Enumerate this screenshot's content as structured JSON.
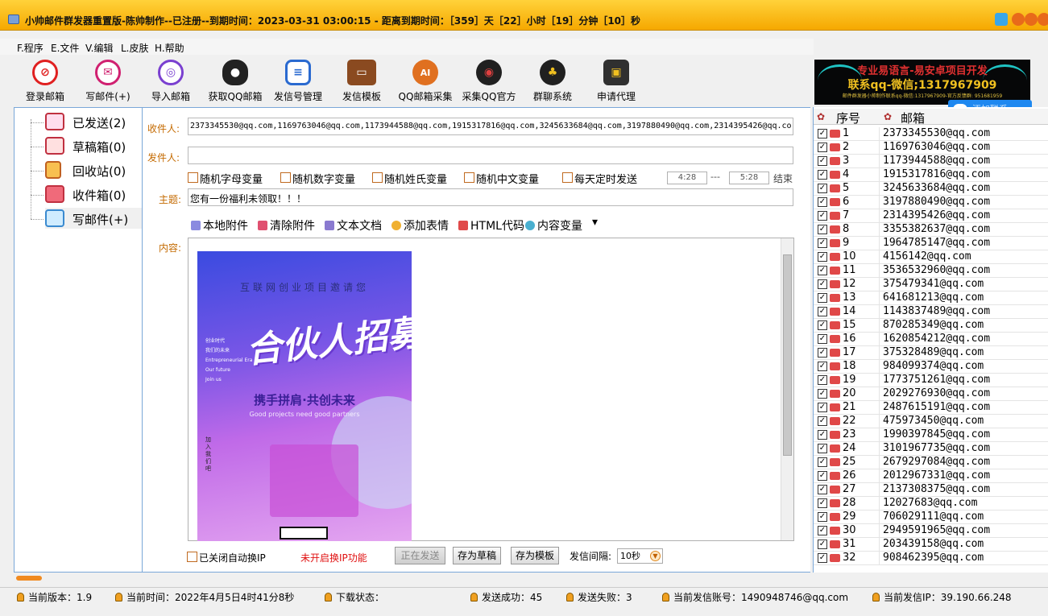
{
  "window": {
    "title": "小帅邮件群发器重置版-陈帅制作--已注册--到期时间：2023-03-31 03:00:15 - 距离到期时间：［359］天［22］小时［19］分钟［10］秒"
  },
  "menu": [
    "F.程序",
    "E.文件",
    "V.编辑",
    "L.皮肤",
    "H.帮助"
  ],
  "toolbar": [
    {
      "label": "登录邮箱",
      "icon": "login-icon",
      "color": "#e02020"
    },
    {
      "label": "写邮件(+)",
      "icon": "compose-icon",
      "color": "#d02070"
    },
    {
      "label": "导入邮箱",
      "icon": "import-icon",
      "color": "#7a40d0"
    },
    {
      "label": "获取QQ邮箱",
      "icon": "qq-penguin-icon",
      "color": "#222222"
    },
    {
      "label": "发信号管理",
      "icon": "account-manage-icon",
      "color": "#2a6ad0"
    },
    {
      "label": "发信模板",
      "icon": "wallet-icon",
      "color": "#8a4a20"
    },
    {
      "label": "QQ邮箱采集",
      "icon": "ai-collect-icon",
      "color": "#e07020"
    },
    {
      "label": "采集QQ官方",
      "icon": "globe-icon",
      "color": "#202020"
    },
    {
      "label": "群聊系统",
      "icon": "group-chat-icon",
      "color": "#202020"
    },
    {
      "label": "申请代理",
      "icon": "agent-icon",
      "color": "#303030"
    }
  ],
  "banner": {
    "line1": "专业易语言-易安卓项目开发",
    "line2": "联系qq-微信;1317967909",
    "line3": "邮件群发器小帅制作联系qq-微信:1317967909-官方反馈群: 951681959"
  },
  "blue_button": {
    "label": "添加联系"
  },
  "sidebar": [
    {
      "label": "已发送(2)",
      "icon": "sent-mail-icon"
    },
    {
      "label": "草稿箱(0)",
      "icon": "drafts-icon"
    },
    {
      "label": "回收站(0)",
      "icon": "trash-icon"
    },
    {
      "label": "收件箱(0)",
      "icon": "inbox-icon"
    },
    {
      "label": "写邮件(+)",
      "icon": "write-mail-icon"
    }
  ],
  "compose": {
    "recipient_label": "收件人:",
    "recipient_value": "2373345530@qq.com,1169763046@qq.com,1173944588@qq.com,1915317816@qq.com,3245633684@qq.com,3197880490@qq.com,2314395426@qq.co",
    "sender_label": "发件人:",
    "sender_value": "",
    "options": [
      "随机字母变量",
      "随机数字变量",
      "随机姓氏变量",
      "随机中文变量",
      "每天定时发送"
    ],
    "time_start": "4:28",
    "time_sep": "---",
    "time_end": "5:28",
    "time_end_label": "结束",
    "subject_label": "主题:",
    "subject_value": "您有一份福利未领取！！！",
    "attachment_tools": [
      {
        "label": "本地附件",
        "icon": "paperclip-icon",
        "color": "#6a6ad0"
      },
      {
        "label": "清除附件",
        "icon": "eraser-icon",
        "color": "#e04060"
      },
      {
        "label": "文本文档",
        "icon": "document-icon",
        "color": "#6a5ac0"
      },
      {
        "label": "添加表情",
        "icon": "emoji-icon",
        "color": "#e0a020"
      },
      {
        "label": "HTML代码",
        "icon": "html-icon",
        "color": "#d03030"
      },
      {
        "label": "内容变量",
        "icon": "variable-icon",
        "color": "#3aa0c0"
      }
    ],
    "dropdown_arrow": "▾",
    "content_label": "内容:",
    "poster": {
      "subtitle": "互联网创业项目邀请您",
      "title": "合伙人招募",
      "slogan": "携手拼肩·共创未来",
      "english": "Good projects need good partners",
      "side_text": "创业时代\n我们的未来\nEntrepreneurial Era\nOur future\nJoin us",
      "vertical_text": "加入我们吧"
    },
    "auto_ip_label": "已关闭自动换IP",
    "ip_warning": "未开启换IP功能",
    "btn_sending": "正在发送",
    "btn_save_draft": "存为草稿",
    "btn_save_template": "存为模板",
    "interval_label": "发信间隔:",
    "interval_value": "10秒"
  },
  "list": {
    "header_num": "序号",
    "header_email": "邮箱",
    "rows": [
      {
        "num": "1",
        "email": "2373345530@qq.com"
      },
      {
        "num": "2",
        "email": "1169763046@qq.com"
      },
      {
        "num": "3",
        "email": "1173944588@qq.com"
      },
      {
        "num": "4",
        "email": "1915317816@qq.com"
      },
      {
        "num": "5",
        "email": "3245633684@qq.com"
      },
      {
        "num": "6",
        "email": "3197880490@qq.com"
      },
      {
        "num": "7",
        "email": "2314395426@qq.com"
      },
      {
        "num": "8",
        "email": "3355382637@qq.com"
      },
      {
        "num": "9",
        "email": "1964785147@qq.com"
      },
      {
        "num": "10",
        "email": "4156142@qq.com"
      },
      {
        "num": "11",
        "email": "3536532960@qq.com"
      },
      {
        "num": "12",
        "email": "375479341@qq.com"
      },
      {
        "num": "13",
        "email": "641681213@qq.com"
      },
      {
        "num": "14",
        "email": "1143837489@qq.com"
      },
      {
        "num": "15",
        "email": "870285349@qq.com"
      },
      {
        "num": "16",
        "email": "1620854212@qq.com"
      },
      {
        "num": "17",
        "email": "375328489@qq.com"
      },
      {
        "num": "18",
        "email": "984099374@qq.com"
      },
      {
        "num": "19",
        "email": "1773751261@qq.com"
      },
      {
        "num": "20",
        "email": "2029276930@qq.com"
      },
      {
        "num": "21",
        "email": "2487615191@qq.com"
      },
      {
        "num": "22",
        "email": "475973450@qq.com"
      },
      {
        "num": "23",
        "email": "1990397845@qq.com"
      },
      {
        "num": "24",
        "email": "3101967735@qq.com"
      },
      {
        "num": "25",
        "email": "2679297084@qq.com"
      },
      {
        "num": "26",
        "email": "2012967331@qq.com"
      },
      {
        "num": "27",
        "email": "2137308375@qq.com"
      },
      {
        "num": "28",
        "email": "12027683@qq.com"
      },
      {
        "num": "29",
        "email": "706029111@qq.com"
      },
      {
        "num": "30",
        "email": "2949591965@qq.com"
      },
      {
        "num": "31",
        "email": "203439158@qq.com"
      },
      {
        "num": "32",
        "email": "908462395@qq.com"
      }
    ]
  },
  "status": [
    {
      "text": "当前版本：1.9"
    },
    {
      "text": "当前时间：2022年4月5日4时41分8秒"
    },
    {
      "text": "下载状态："
    },
    {
      "text": "发送成功：45"
    },
    {
      "text": "发送失败：3"
    },
    {
      "text": "当前发信账号：1490948746@qq.com"
    },
    {
      "text": "当前发信IP：39.190.66.248"
    }
  ]
}
